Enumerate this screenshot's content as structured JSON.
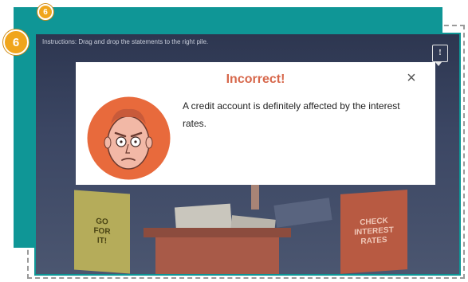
{
  "badges": {
    "small": "6",
    "large": "6"
  },
  "scene": {
    "instructions": "Instructions: Drag and drop the statements to the right pile.",
    "info_button": "!",
    "folder_left": "GO\nFOR\nIT!",
    "folder_right": "CHECK\nINTEREST\nRATES"
  },
  "feedback": {
    "title": "Incorrect!",
    "message": "A credit account is definitely affected by the interest rates.",
    "close_label": "×"
  },
  "colors": {
    "teal": "#0f9696",
    "badge": "#f0a51c",
    "title_red": "#d7684c",
    "avatar_orange": "#e86a3c"
  }
}
